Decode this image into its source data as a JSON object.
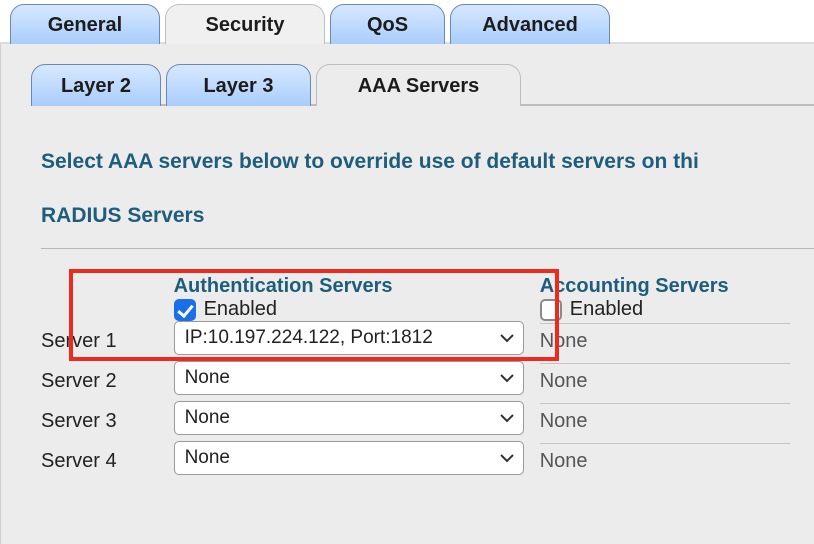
{
  "top_tabs": {
    "general": "General",
    "security": "Security",
    "qos": "QoS",
    "advanced": "Advanced"
  },
  "sub_tabs": {
    "layer2": "Layer 2",
    "layer3": "Layer 3",
    "aaa": "AAA Servers"
  },
  "instruction": "Select AAA servers below to override use of default servers on thi",
  "section_title": "RADIUS Servers",
  "columns": {
    "auth": "Authentication Servers",
    "acct": "Accounting Servers"
  },
  "enabled_label": "Enabled",
  "auth_enabled": true,
  "acct_enabled": false,
  "rows": [
    {
      "label": "Server 1",
      "auth_value": "IP:10.197.224.122, Port:1812",
      "acct_value": "None"
    },
    {
      "label": "Server 2",
      "auth_value": "None",
      "acct_value": "None"
    },
    {
      "label": "Server 3",
      "auth_value": "None",
      "acct_value": "None"
    },
    {
      "label": "Server 4",
      "auth_value": "None",
      "acct_value": "None"
    }
  ]
}
